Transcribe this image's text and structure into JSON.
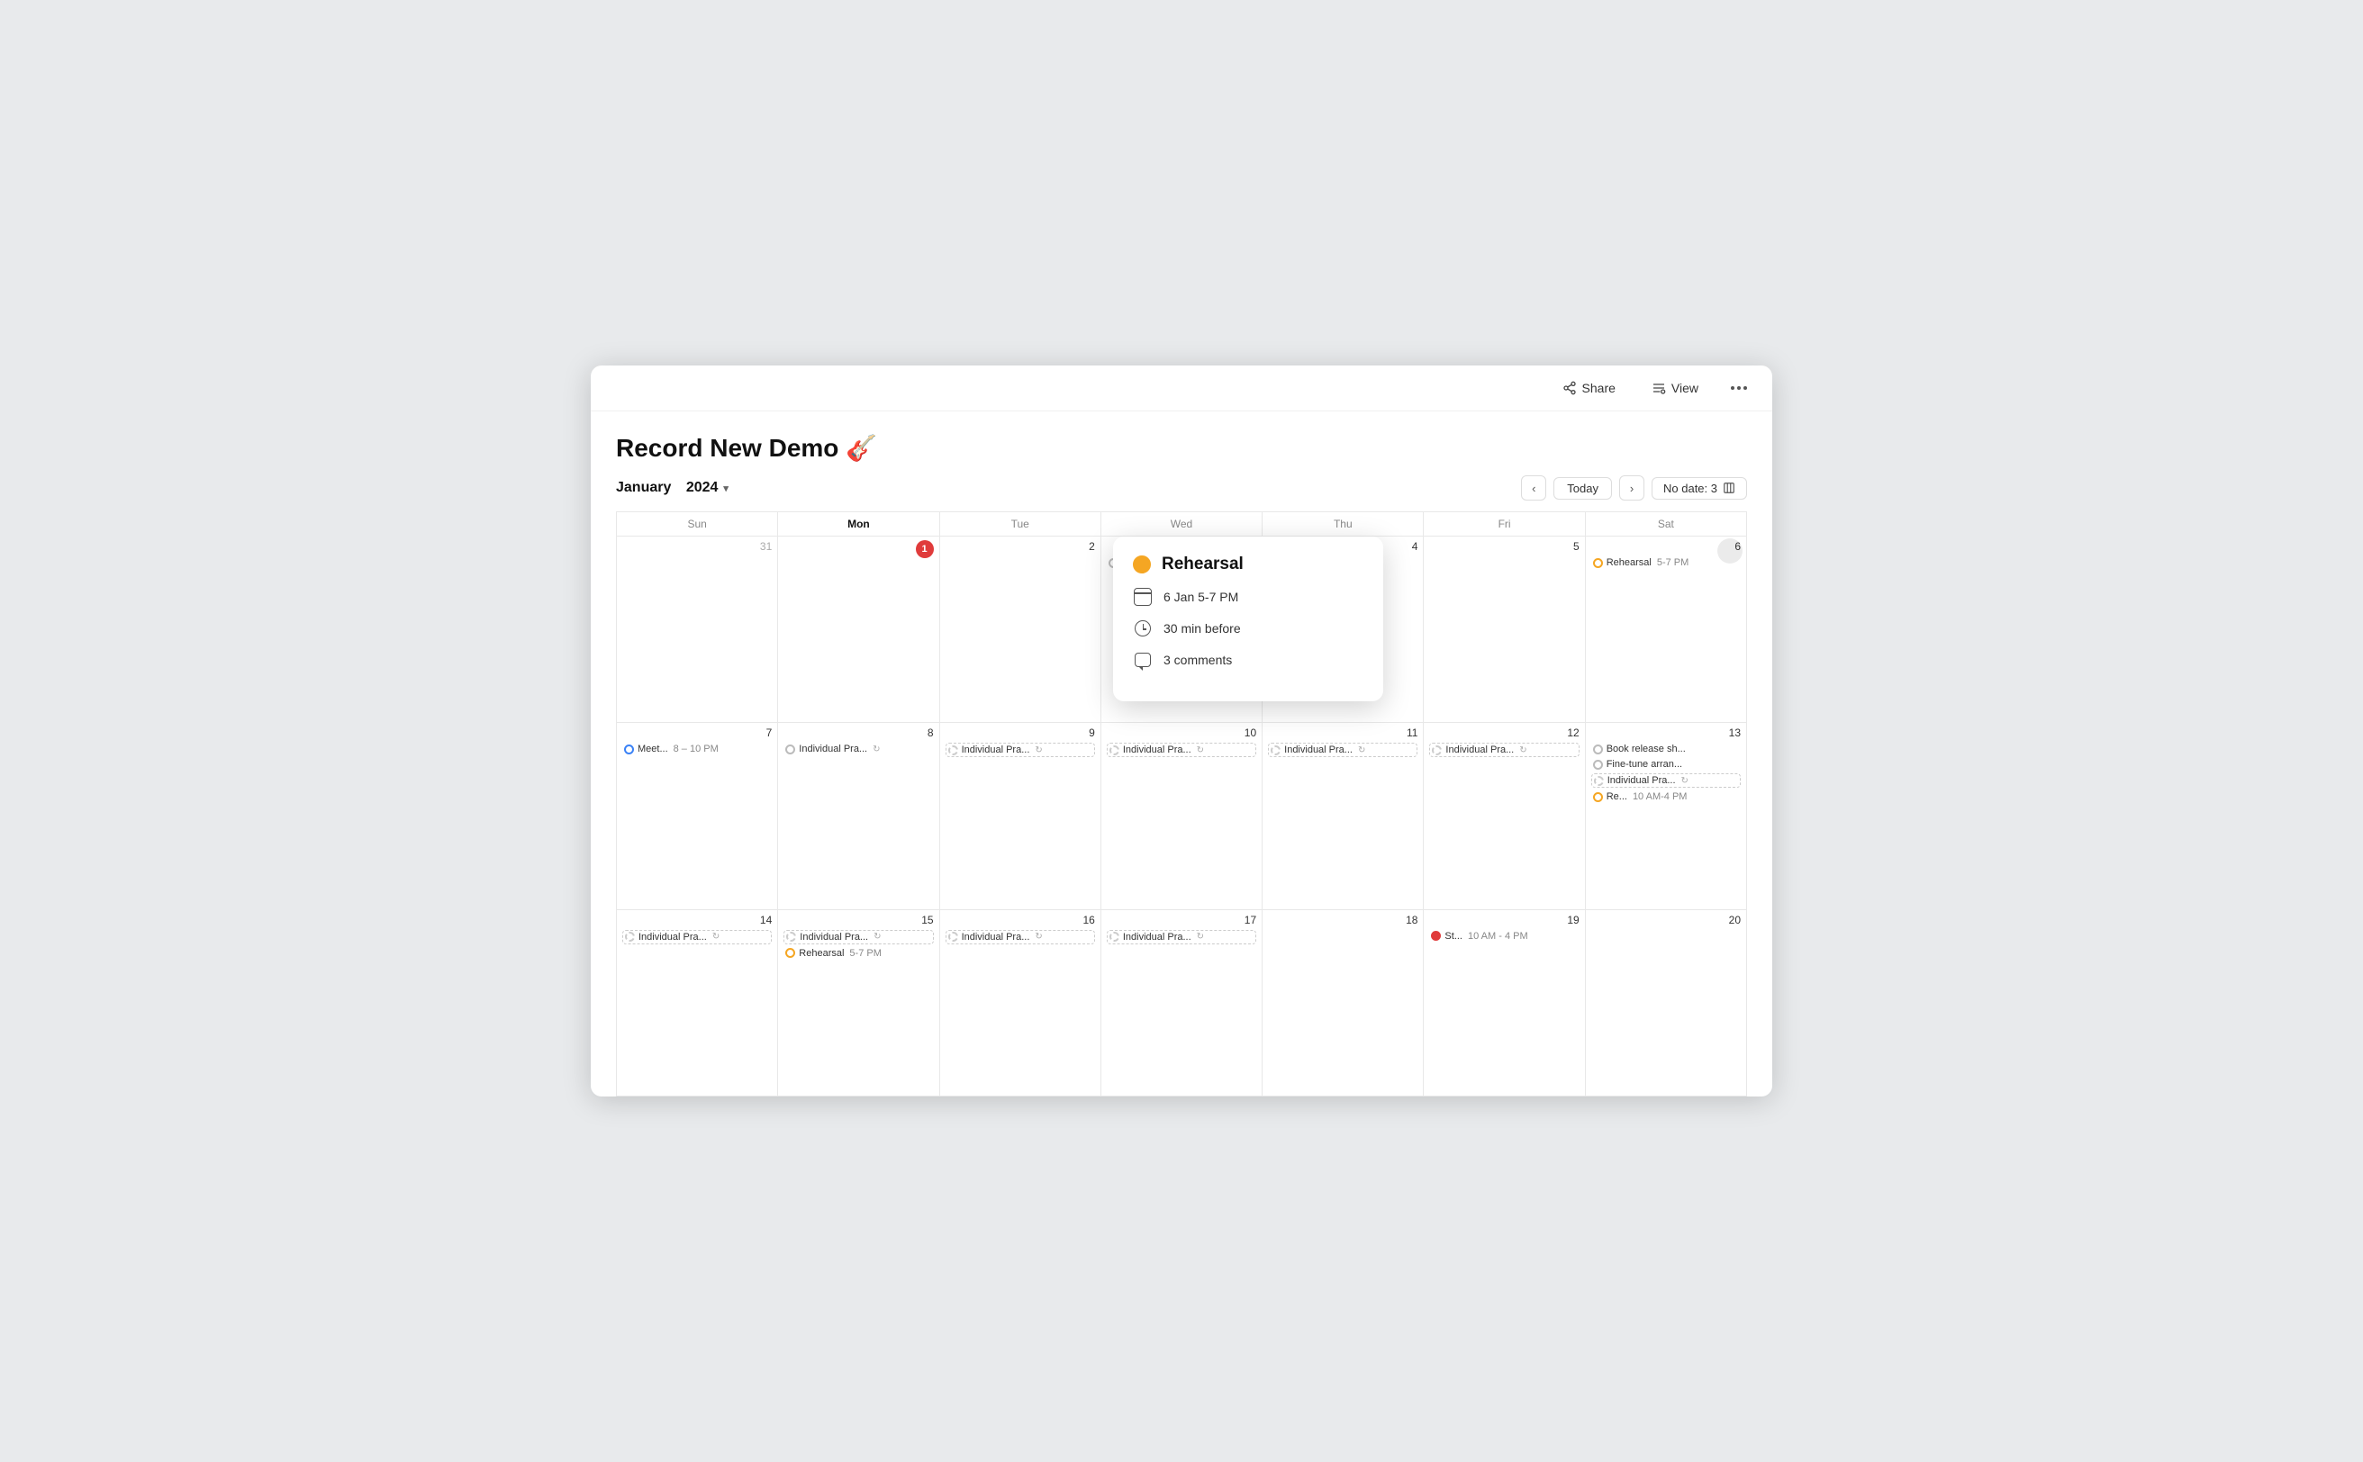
{
  "window": {
    "title": "Record New Demo"
  },
  "topbar": {
    "share_label": "Share",
    "view_label": "View"
  },
  "page": {
    "title": "Record New Demo",
    "title_emoji": "🎸"
  },
  "calendar": {
    "month_label": "January",
    "year_label": "2024",
    "today_label": "Today",
    "no_date_label": "No date: 3",
    "day_headers": [
      "Sun",
      "Mon",
      "Tue",
      "Wed",
      "Thu",
      "Fri",
      "Sat"
    ],
    "popup": {
      "title": "Rehearsal",
      "date_label": "6 Jan 5-7 PM",
      "reminder_label": "30 min before",
      "comments_label": "3 comments"
    }
  }
}
